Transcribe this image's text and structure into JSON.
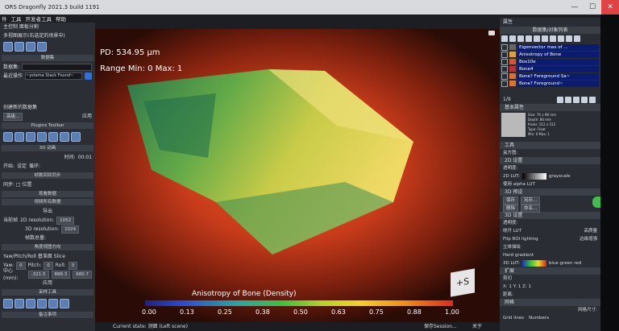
{
  "window": {
    "title": "ORS Dragonfly 2021.3 build 1191",
    "ctrl_min": "—",
    "ctrl_max": "☐",
    "ctrl_close": "✕"
  },
  "menu": [
    "件",
    "工具",
    "开发者工具",
    "帮助"
  ],
  "left": {
    "tabs_row": "主控制   面板分割",
    "group1": "多视图展示(右选定的场景中)",
    "sect_dataset": "数据集",
    "dataset_label": "数据集:",
    "recent_label": "最近操作",
    "recent_value": "~ystema Stack Found~",
    "chk_create": "创建新的数据集",
    "btn_apply": "应用",
    "btn_high": "高级...",
    "sect_plugin": "Plugins Toolbar",
    "sect_3d": "3D 动画",
    "time_label": "时间:",
    "time_value": "00:01",
    "start_label": "开始:",
    "setpos": "设定",
    "loop": "循环:",
    "sect_frames": "帧数回到同步",
    "sync": "同步: □ 位置",
    "sect_vr": "观看数据",
    "sect_vr2": "视频所有数据",
    "sect_res": "导出",
    "export_label": "当前帧",
    "res2d_label": "2D resolution:",
    "res2d_value": "1052",
    "res3d_label": "3D resolution:",
    "res3d_value": "1024",
    "count_label": "帧数总量:",
    "sect_view": "角度视图方向",
    "ypr": "Yaw/Pitch/Roll   基准面   Slice",
    "yaw_label": "Yaw:",
    "yaw_value": "0",
    "pitch_label": "Pitch:",
    "pitch_value": "0",
    "roll_label": "Roll:",
    "roll_value": "0",
    "center_label": "中心(mm):",
    "center_x": "-321.5",
    "center_y": "888.3",
    "center_z": "680.7",
    "apply2": "应用",
    "sect_tools": "采样工具",
    "sect_bottom": "备注事项"
  },
  "viewport": {
    "pd_label": "PD: 534.95 µm",
    "range_label": "Range Min: 0 Max: 1",
    "colorbar_title": "Anisotropy of Bone (Density)",
    "ticks": [
      "0.00",
      "0.13",
      "0.25",
      "0.38",
      "0.50",
      "0.63",
      "0.75",
      "0.88",
      "1.00"
    ],
    "cube_face": "+S"
  },
  "status": {
    "scene": "Current state: 测面 (Left scene)",
    "save": "保存Session...",
    "about": "关于"
  },
  "right": {
    "header": "属性",
    "layers_hdr": "数据集/对象列表",
    "layers": [
      "Eigenvector max of ...",
      "Anisotropy of Bone",
      "Box10e",
      "Bone4",
      "Bone? Foreground Sa~",
      "Bone? Foreground~"
    ],
    "count": "1/9",
    "sect_basic": "基本属性",
    "info_lines": [
      "Size: 76 x 98 mm",
      "Depth: 86 mm",
      "Pixels: 512 x 512",
      "Type: Float",
      "Min: 0  Max: 1"
    ],
    "sect_tools": "工具",
    "toolbox": "盒方图:",
    "sect_2d": "2D 设置",
    "opacity": "透明度:",
    "lut_label": "2D LUT:",
    "lut_value": "grayscale",
    "alpha": "使用 alpha LUT",
    "sect_3d": "3D 预设",
    "preset_btns": [
      "保存",
      "另存..."
    ],
    "delete_btns": [
      "删除",
      "命名..."
    ],
    "sect_3ds": "3D 设置",
    "opacity3": "透明度:",
    "checks": [
      "绕开 LUT",
      "高质量",
      "Flip ROI lighting",
      "边缘增强",
      "立体描绘",
      "Hard gradient"
    ],
    "lut3_label": "3D LUT:",
    "lut3_value": "blue green red",
    "sect_ext": "扩展",
    "clip": "剪切",
    "xyz": "X: 1   Y: 1   Z: 1",
    "dist": "距离:",
    "sect_grid": "网格",
    "grid_size": "网格尺寸:",
    "grid_lines": "Grid lines",
    "grid_labels": "Numbers"
  }
}
